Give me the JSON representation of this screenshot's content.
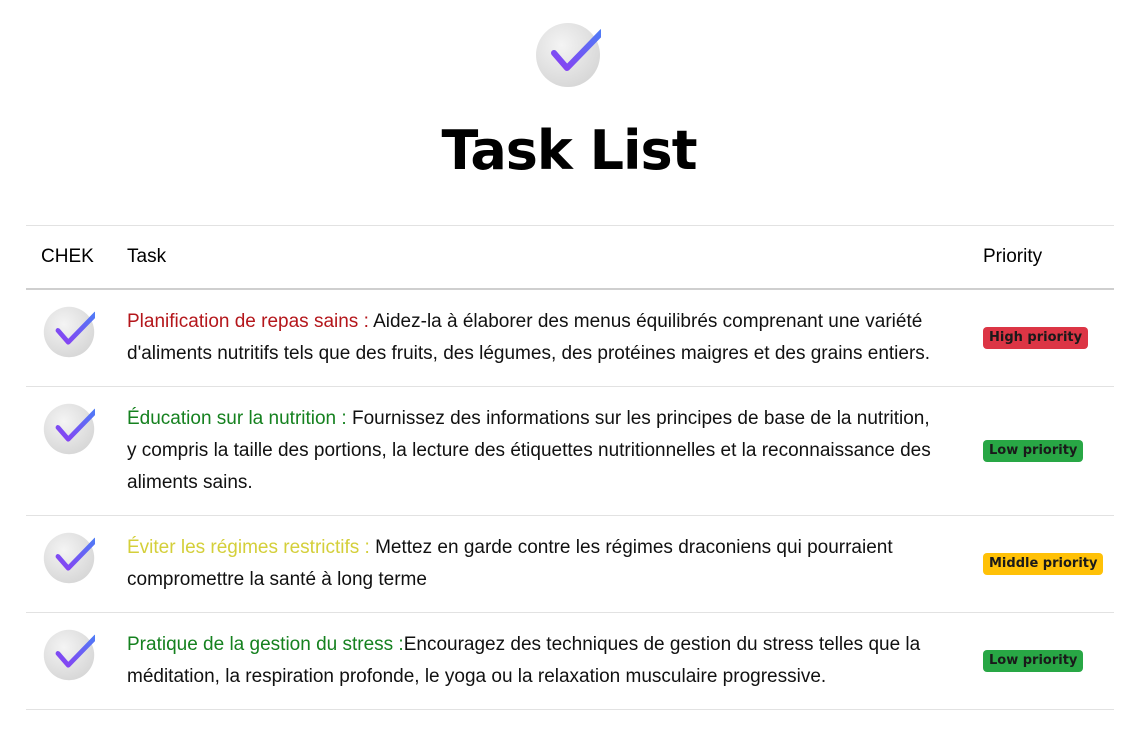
{
  "header": {
    "logo_icon": "check-circle-icon",
    "title": "Task List"
  },
  "table": {
    "columns": {
      "check": "CHEK",
      "task": "Task",
      "priority": "Priority"
    },
    "rows": [
      {
        "icon": "check-circle-icon",
        "name": "Planification de repas sains : ",
        "name_color": "#b4161b",
        "description": "Aidez-la à élaborer des menus équilibrés comprenant une variété d'aliments nutritifs tels que des fruits, des légumes, des protéines maigres et des grains entiers.",
        "priority": "High priority",
        "priority_color": "#dc3545"
      },
      {
        "icon": "check-circle-icon",
        "name": "Éducation sur la nutrition : ",
        "name_color": "#15811f",
        "description": "Fournissez des informations sur les principes de base de la nutrition, y compris la taille des portions, la lecture des étiquettes nutritionnelles et la reconnaissance des aliments sains.",
        "priority": "Low priority",
        "priority_color": "#28a745"
      },
      {
        "icon": "check-circle-icon",
        "name": "Éviter les régimes restrictifs : ",
        "name_color": "#d4cf3a",
        "description": "Mettez en garde contre les régimes draconiens qui pourraient compromettre la santé à long terme",
        "priority": "Middle priority",
        "priority_color": "#ffc107"
      },
      {
        "icon": "check-circle-icon",
        "name": "Pratique de la gestion du stress :",
        "name_color": "#15811f",
        "description": "Encouragez des techniques de gestion du stress telles que la méditation, la respiration profonde, le yoga ou la relaxation musculaire progressive.",
        "priority": "Low priority",
        "priority_color": "#28a745"
      }
    ]
  }
}
